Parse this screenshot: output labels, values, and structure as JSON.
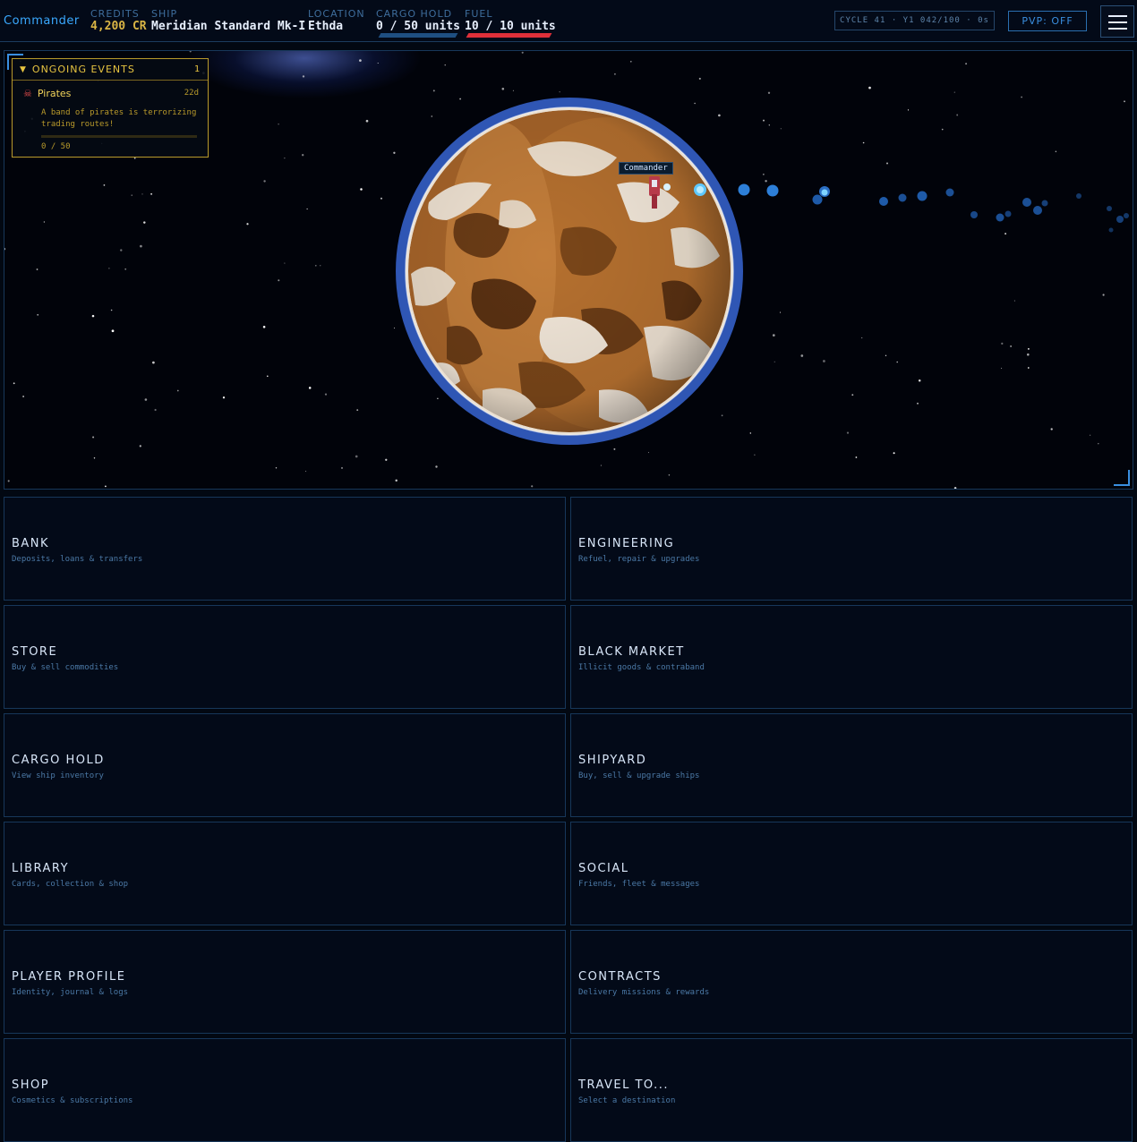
{
  "header": {
    "pilot": "Commander",
    "credits_label": "CREDITS",
    "credits_value": "4,200 CR",
    "ship_label": "SHIP",
    "ship_value": "Meridian Standard Mk-I",
    "location_label": "LOCATION",
    "location_value": "Ethda",
    "cargo_label": "CARGO HOLD",
    "cargo_value": "0 / 50 units",
    "cargo_fill": 0,
    "fuel_label": "FUEL",
    "fuel_value": "10 / 10 units",
    "fuel_fill": 1,
    "cycle": "CYCLE 41 · Y1 042/100 · 0s",
    "pvp": "PVP: OFF",
    "menu_icon": "hamburger-menu-icon"
  },
  "events": {
    "title": "ONGOING EVENTS",
    "count": "1",
    "items": [
      {
        "icon": "skull-crossbones-icon",
        "name": "Pirates",
        "days": "22d",
        "description": "A band of pirates is terrorizing trading routes!",
        "progress": "0 / 50",
        "progress_fill": 0
      }
    ]
  },
  "scene": {
    "ship_label": "Commander",
    "planet_color": "#a8652a",
    "atmosphere_color": "#2f56b4"
  },
  "actions": [
    {
      "name": "BANK",
      "sub": "Deposits, loans & transfers"
    },
    {
      "name": "ENGINEERING",
      "sub": "Refuel, repair & upgrades"
    },
    {
      "name": "STORE",
      "sub": "Buy & sell commodities"
    },
    {
      "name": "BLACK MARKET",
      "sub": "Illicit goods & contraband"
    },
    {
      "name": "CARGO HOLD",
      "sub": "View ship inventory"
    },
    {
      "name": "SHIPYARD",
      "sub": "Buy, sell & upgrade ships"
    },
    {
      "name": "LIBRARY",
      "sub": "Cards, collection & shop"
    },
    {
      "name": "SOCIAL",
      "sub": "Friends, fleet & messages"
    },
    {
      "name": "PLAYER PROFILE",
      "sub": "Identity, journal & logs"
    },
    {
      "name": "CONTRACTS",
      "sub": "Delivery missions & rewards"
    },
    {
      "name": "SHOP",
      "sub": "Cosmetics & subscriptions"
    },
    {
      "name": "TRAVEL TO...",
      "sub": "Select a destination"
    }
  ],
  "colors": {
    "accent": "#3a8fe0",
    "gold": "#d9b545",
    "cargo_bar": "#1f4f82",
    "fuel_bar": "#e0303a"
  }
}
